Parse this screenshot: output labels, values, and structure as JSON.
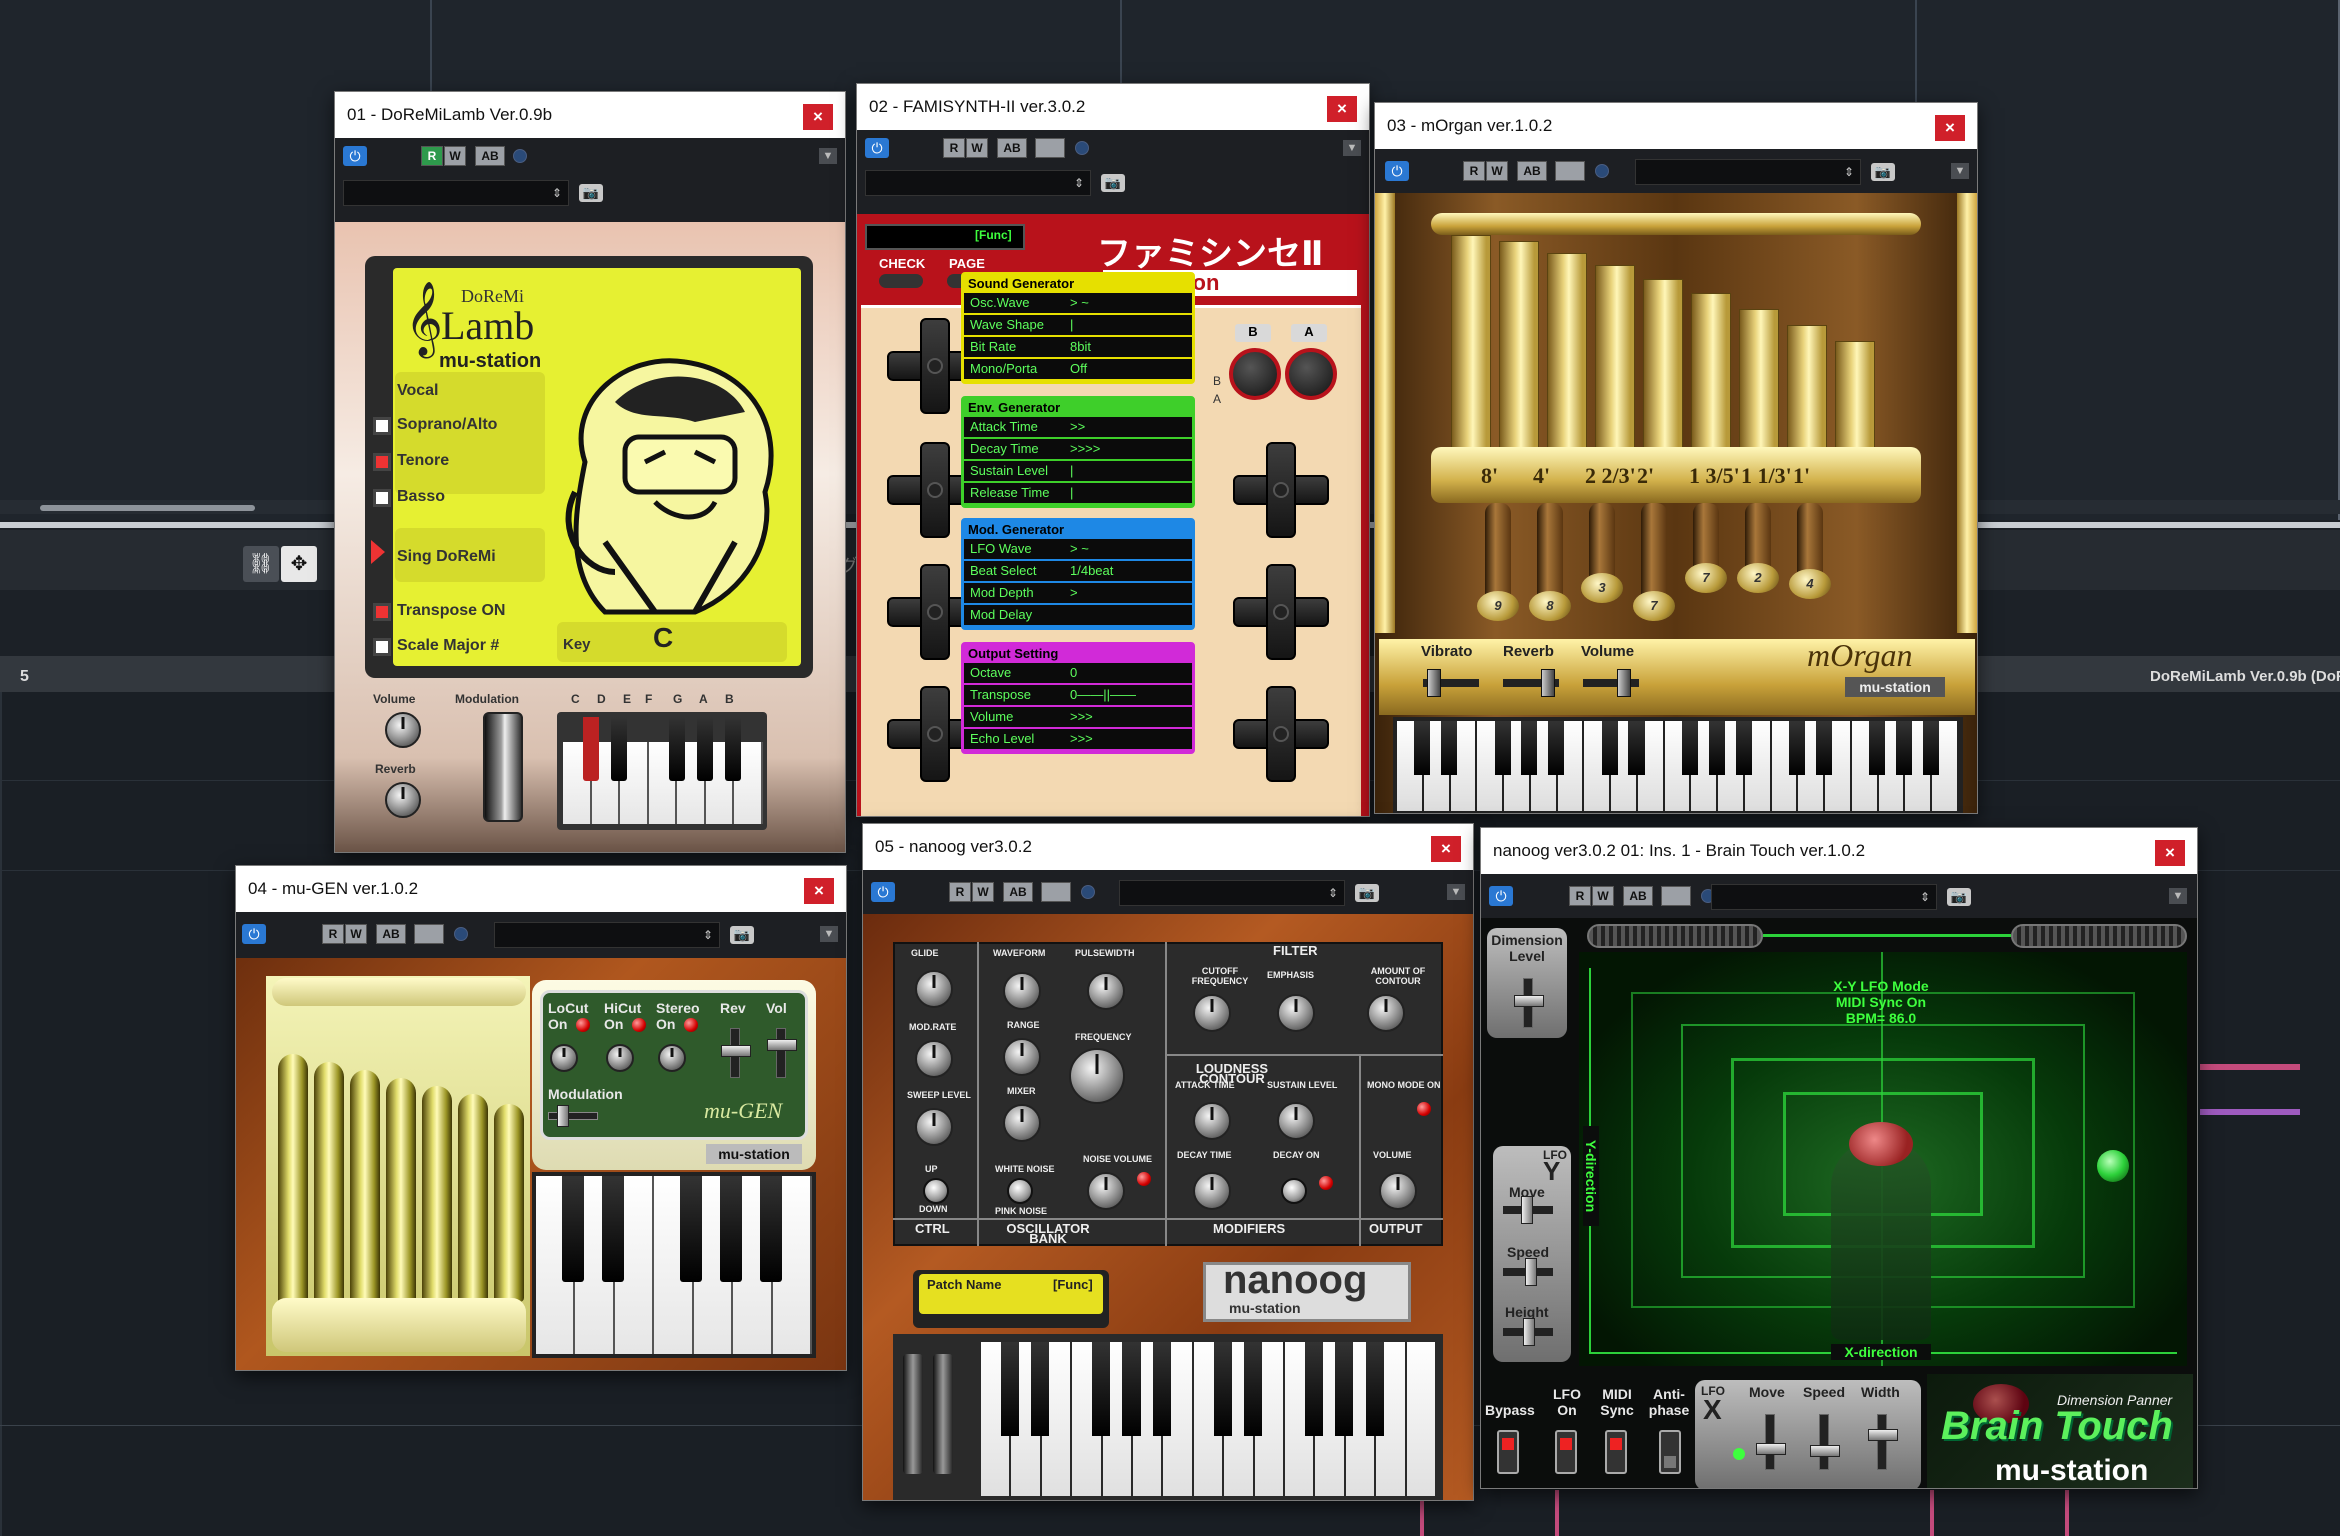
{
  "daw": {
    "ruler_label": "5",
    "track_label": "DoReMiLamb Ver.0.9b (DoRe",
    "partial_text": "グ"
  },
  "windows": {
    "w01": {
      "title": "01 - DoReMiLamb Ver.0.9b",
      "close": "×",
      "brand_small": "DoReMi",
      "brand_big": "Lamb",
      "brand_sub": "mu-station",
      "vocal_label": "Vocal",
      "voices": [
        "Soprano/Alto",
        "Tenore",
        "Basso"
      ],
      "sing_label": "Sing  DoReMi",
      "transpose_label": "Transpose  ON",
      "scale_label": "Scale  Major #",
      "key_label": "Key",
      "key_value": "C",
      "volume_label": "Volume",
      "reverb_label": "Reverb",
      "modulation_label": "Modulation",
      "note_names": [
        "C",
        "D",
        "E",
        "F",
        "G",
        "A",
        "B"
      ]
    },
    "w02": {
      "title": "02 - FAMISYNTH-II ver.3.0.2",
      "close": "×",
      "func_label": "[Func]",
      "check_label": "CHECK",
      "page_label": "PAGE",
      "logo_jp": "ファミシンセⅡ",
      "logo_sub": "mu-station",
      "btn_b": "B",
      "btn_a": "A",
      "side_b": "B",
      "side_a": "A",
      "sections": [
        {
          "name": "Sound Generator",
          "color": "#e6e000",
          "rows": [
            [
              "Osc.Wave",
              "> ~"
            ],
            [
              "Wave Shape",
              "|"
            ],
            [
              "Bit Rate",
              "8bit"
            ],
            [
              "Mono/Porta",
              "Off"
            ]
          ]
        },
        {
          "name": "Env. Generator",
          "color": "#3ecf2a",
          "rows": [
            [
              "Attack Time",
              ">>"
            ],
            [
              "Decay Time",
              ">>>>"
            ],
            [
              "Sustain Level",
              "|"
            ],
            [
              "Release Time",
              "|"
            ]
          ]
        },
        {
          "name": "Mod. Generator",
          "color": "#1e88e5",
          "rows": [
            [
              "LFO Wave",
              "> ~"
            ],
            [
              "Beat Select",
              "1/4beat"
            ],
            [
              "Mod Depth",
              ">"
            ],
            [
              "Mod Delay",
              ""
            ]
          ]
        },
        {
          "name": "Output Setting",
          "color": "#d12ad8",
          "rows": [
            [
              "Octave",
              "0"
            ],
            [
              "Transpose",
              "0——||——"
            ],
            [
              "Volume",
              ">>>"
            ],
            [
              "Echo Level",
              ">>>"
            ]
          ]
        }
      ]
    },
    "w03": {
      "title": "03 - mOrgan ver.1.0.2",
      "close": "×",
      "footages": [
        "8'",
        "4'",
        "2 2/3'",
        "2'",
        "1 3/5'",
        "1 1/3'",
        "1'"
      ],
      "lever_values": [
        "9",
        "8",
        "3",
        "7",
        "7",
        "2",
        "4"
      ],
      "vibrato_label": "Vibrato",
      "reverb_label": "Reverb",
      "volume_label": "Volume",
      "logo": "mOrgan",
      "logo_sub": "mu-station"
    },
    "w04": {
      "title": "04 - mu-GEN ver.1.0.2",
      "close": "×",
      "locut": "LoCut",
      "hicut": "HiCut",
      "stereo": "Stereo",
      "on1": "On",
      "on2": "On",
      "on3": "On",
      "rev": "Rev",
      "vol": "Vol",
      "modulation": "Modulation",
      "logo": "mu-GEN",
      "logo_sub": "mu-station"
    },
    "w05": {
      "title": "05 - nanoog ver3.0.2",
      "close": "×",
      "glide": "GLIDE",
      "waveform": "WAVEFORM",
      "pulsewidth": "PULSEWIDTH",
      "filter": "FILTER",
      "cutoff": "CUTOFF FREQUENCY",
      "emphasis": "EMPHASIS",
      "amount": "AMOUNT OF CONTOUR",
      "modrate": "MOD.RATE",
      "range": "RANGE",
      "frequency": "FREQUENCY",
      "loudness": "LOUDNESS CONTOUR",
      "sweep": "SWEEP LEVEL",
      "mixer": "MIXER",
      "attack": "ATTACK TIME",
      "sustain": "SUSTAIN LEVEL",
      "monomode": "MONO MODE ON",
      "noisevol": "NOISE VOLUME",
      "decay": "DECAY TIME",
      "decayon": "DECAY ON",
      "volume": "VOLUME",
      "up": "UP",
      "down": "DOWN",
      "white": "WHITE NOISE",
      "pink": "PINK NOISE",
      "ctrl": "CTRL",
      "oscbank": "OSCILLATOR BANK",
      "modifiers": "MODIFIERS",
      "output": "OUTPUT",
      "patch": "Patch Name",
      "func": "[Func]",
      "logo": "nanoog",
      "logo_sub": "mu-station"
    },
    "w06": {
      "title": "nanoog ver3.0.2 01: Ins. 1 - Brain Touch ver.1.0.2",
      "close": "×",
      "dimension": "Dimension Level",
      "mode_line1": "X-Y LFO Mode",
      "mode_line2": "MIDI Sync On",
      "mode_line3": "BPM= 86.0",
      "ydir": "Y-direction",
      "xdir": "X-direction",
      "lfo": "LFO",
      "y": "Y",
      "x": "X",
      "move": "Move",
      "speed": "Speed",
      "height": "Height",
      "width": "Width",
      "bypass": "Bypass",
      "lfo_on": "LFO On",
      "midi_sync": "MIDI Sync",
      "anti_phase": "Anti-phase",
      "dim_panner": "Dimension Panner",
      "logo": "Brain Touch",
      "logo_sub": "mu-station"
    }
  },
  "toolbar": {
    "power": "⏻",
    "r": "R",
    "w": "W",
    "ab": "AB",
    "preset_arrows": "⇕",
    "camera": "📷",
    "menu": "▼"
  },
  "colors": {
    "famisynth_red": "#b8121b",
    "doremi_yellow": "#e6f032",
    "organ_gold": "#c9a23a",
    "brain_green": "#27d13a",
    "daw_bg": "#1c2127"
  }
}
